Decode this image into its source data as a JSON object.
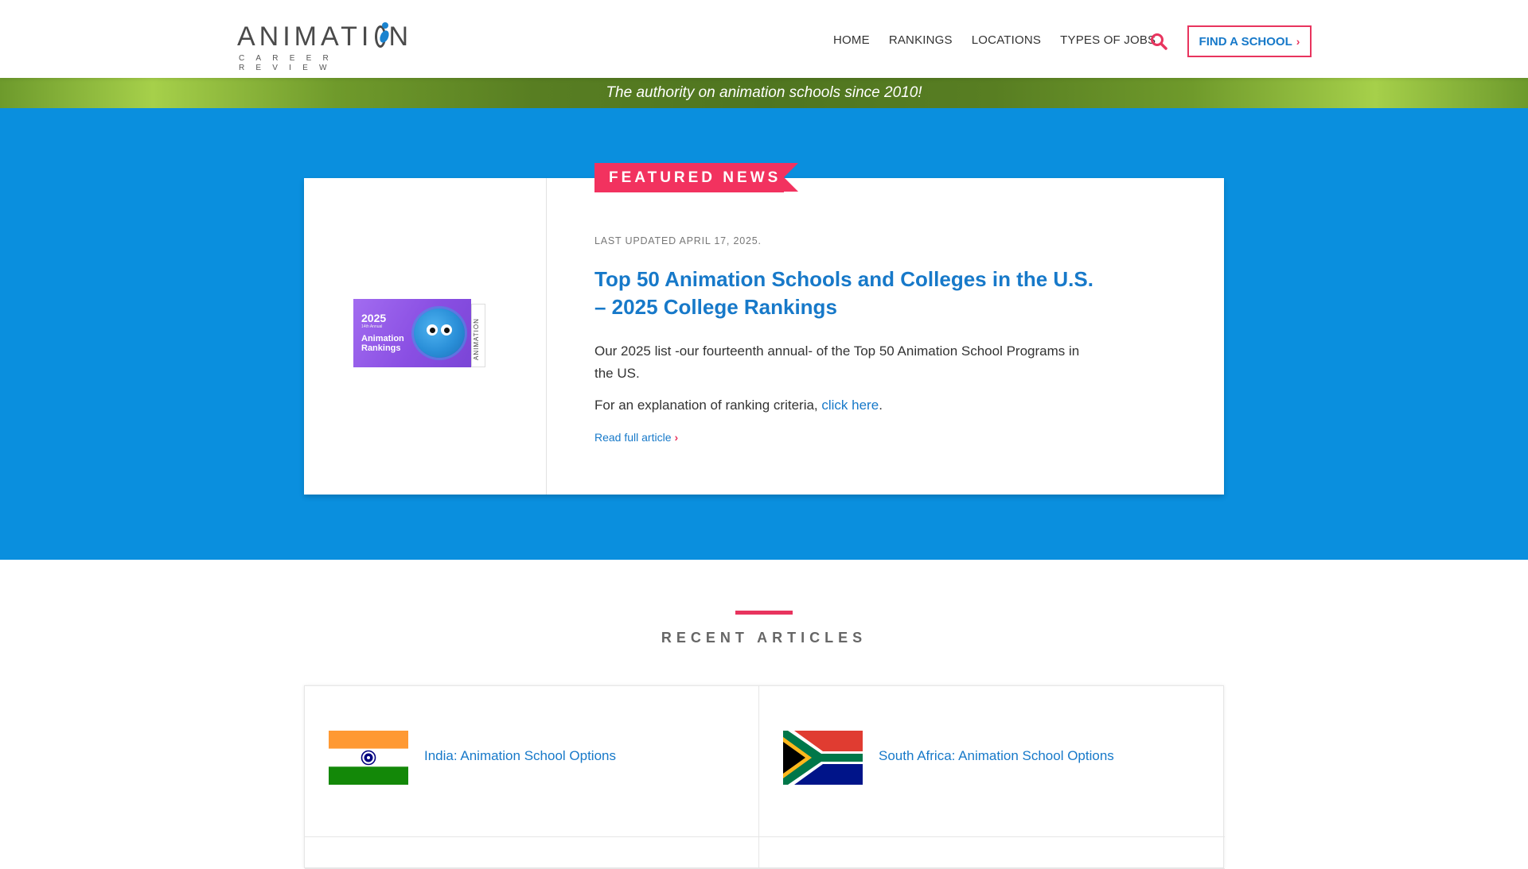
{
  "header": {
    "logo": {
      "word": "ANIMATION",
      "subtitle": "CAREER REVIEW"
    },
    "nav": [
      "HOME",
      "RANKINGS",
      "LOCATIONS",
      "TYPES OF JOBS"
    ],
    "search_icon": "search-icon",
    "find_button_label": "FIND A SCHOOL",
    "find_button_chevron": "›"
  },
  "tagline": "The authority on animation schools since 2010!",
  "featured": {
    "ribbon_label": "FEATURED NEWS",
    "updated": "LAST UPDATED APRIL 17, 2025.",
    "title": "Top 50 Animation Schools and Colleges in the U.S. – 2025 College Rankings",
    "description": "Our 2025 list -our fourteenth annual- of the Top 50 Animation School Programs in the US.",
    "criteria_prefix": "For an explanation of ranking criteria, ",
    "criteria_link": "click here",
    "criteria_suffix": ".",
    "read_more": "Read full article",
    "thumbnail": {
      "year": "2025",
      "small_text": "14th Annual",
      "title": "Animation Rankings",
      "side_text": "ANIMATION"
    }
  },
  "recent": {
    "heading": "RECENT ARTICLES",
    "articles": [
      {
        "title": "India: Animation School Options",
        "flag": "india-flag-icon"
      },
      {
        "title": "South Africa: Animation School Options",
        "flag": "south-africa-flag-icon"
      }
    ]
  },
  "colors": {
    "accent_pink": "#e8345e",
    "link_blue": "#1779c9",
    "hero_blue": "#0a8fde",
    "tagline_green": "#6f9a2b"
  }
}
